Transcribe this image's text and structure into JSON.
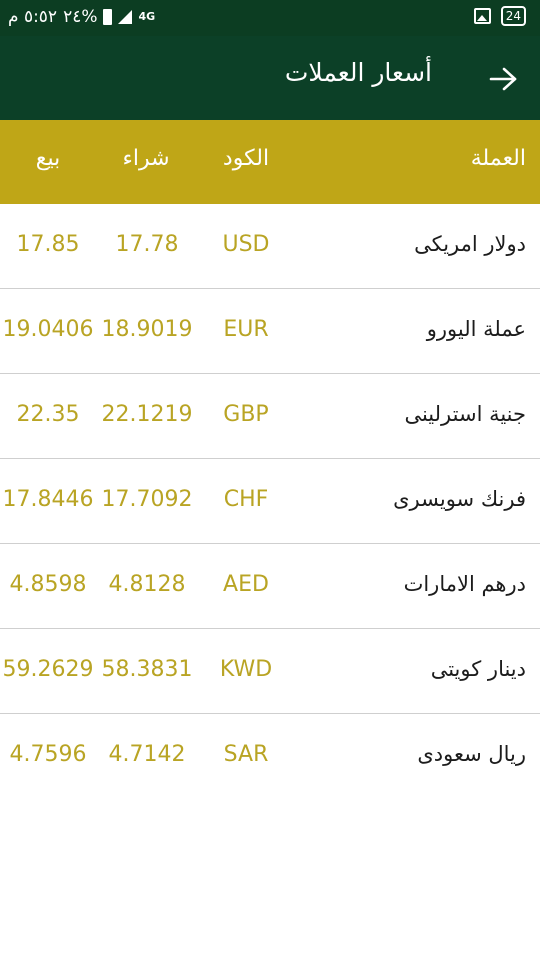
{
  "status_bar": {
    "time": "٥:٥٢ م",
    "battery": "٢٤%",
    "network": "4G",
    "notification_count": "24"
  },
  "app_bar": {
    "title": "أسعار العملات"
  },
  "table": {
    "headers": {
      "currency": "العملة",
      "code": "الكود",
      "buy": "شراء",
      "sell": "بيع"
    },
    "rows": [
      {
        "name": "دولار امريكى",
        "code": "USD",
        "buy": "17.78",
        "sell": "17.85"
      },
      {
        "name": "عملة اليورو",
        "code": "EUR",
        "buy": "18.9019",
        "sell": "19.0406"
      },
      {
        "name": "جنية استرلينى",
        "code": "GBP",
        "buy": "22.1219",
        "sell": "22.35"
      },
      {
        "name": "فرنك سويسرى",
        "code": "CHF",
        "buy": "17.7092",
        "sell": "17.8446"
      },
      {
        "name": "درهم الامارات",
        "code": "AED",
        "buy": "4.8128",
        "sell": "4.8598"
      },
      {
        "name": "دينار كويتى",
        "code": "KWD",
        "buy": "58.3831",
        "sell": "59.2629"
      },
      {
        "name": "ريال سعودى",
        "code": "SAR",
        "buy": "4.7142",
        "sell": "4.7596"
      }
    ]
  },
  "colors": {
    "app_bar": "#0c4027",
    "status_bar": "#0c3d22",
    "header": "#bfa617",
    "value_text": "#b9a424"
  }
}
